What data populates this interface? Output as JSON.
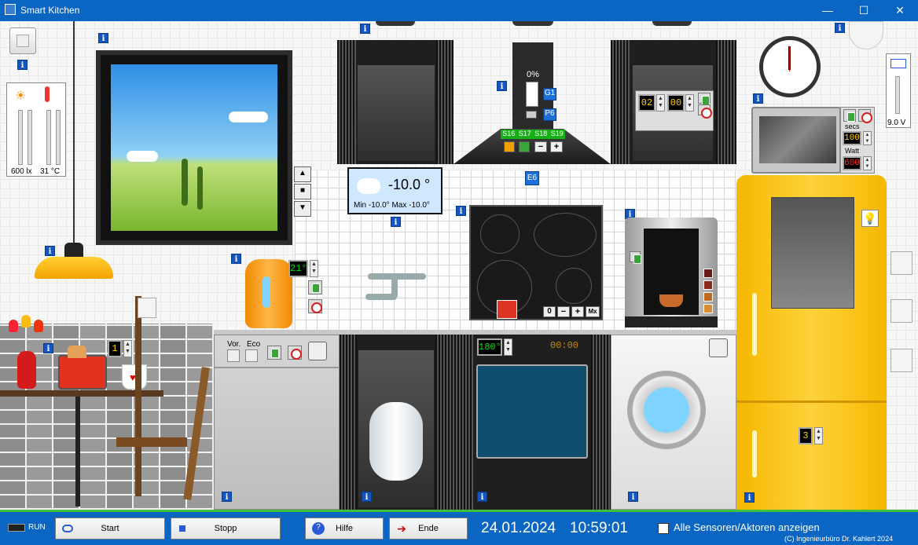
{
  "window": {
    "title": "Smart Kitchen",
    "minimize": "—",
    "maximize": "☐",
    "close": "✕"
  },
  "info_glyph": "i",
  "sensor_panel": {
    "lux": "600 lx",
    "temp": "31 °C"
  },
  "battery": {
    "value": "9.0 V"
  },
  "weather": {
    "temp": "-10.0 °",
    "minmax": "Min -10.0° Max -10.0°"
  },
  "hood": {
    "percent": "0%",
    "g1": "G1",
    "p6": "P6",
    "s16": "S16",
    "s17": "S17",
    "s18": "S18",
    "s19": "S19",
    "minus": "−",
    "plus": "+",
    "e6": "E6"
  },
  "oven_upper": {
    "hours": "02",
    "minutes": "00"
  },
  "microwave": {
    "secs_label": "secs",
    "secs": "100",
    "watt_label": "Watt",
    "watt": "600"
  },
  "kettle": {
    "temp": "21°"
  },
  "toaster": {
    "level": "1"
  },
  "cooktop": {
    "level": "0",
    "minus": "−",
    "plus": "+",
    "max": "Mx"
  },
  "dishwasher": {
    "vor": "Vor.",
    "eco": "Eco"
  },
  "oven": {
    "temp": "180°",
    "time": "00:00"
  },
  "fridge": {
    "level": "3"
  },
  "bottom": {
    "run": "RUN",
    "start": "Start",
    "stopp": "Stopp",
    "hilfe": "Hilfe",
    "ende": "Ende",
    "date": "24.01.2024",
    "time": "10:59:01",
    "show_all": "Alle Sensoren/Aktoren anzeigen",
    "copyright": "(C) Ingenieurbüro Dr. Kahlert 2024"
  },
  "colors": {
    "titlebar": "#0a66c2",
    "accent_green": "#3ec23e",
    "fridge": "#f5b800",
    "info": "#1455c0"
  }
}
